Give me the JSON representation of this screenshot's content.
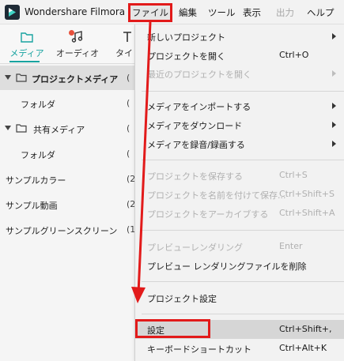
{
  "titlebar": {
    "app_title": "Wondershare Filmora",
    "logo_icon": "filmora-logo-icon",
    "menu": {
      "file": "ファイル",
      "edit": "編集",
      "tool": "ツール",
      "view": "表示",
      "export": "出力",
      "help": "ヘルプ"
    }
  },
  "left_panel": {
    "tabs": [
      {
        "label": "メディア",
        "icon": "folder-icon",
        "active": true
      },
      {
        "label": "オーディオ",
        "icon": "music-note-icon",
        "active": false
      },
      {
        "label": "タイ",
        "icon": "title-icon",
        "active": false
      }
    ],
    "tree": {
      "project_media": "プロジェクトメディア",
      "folder1": "フォルダ",
      "shared_media": "共有メディア",
      "folder2": "フォルダ",
      "sample_color": "サンプルカラー",
      "sample_color_count": "(2",
      "sample_video": "サンプル動画",
      "sample_video_count": "(2",
      "sample_green": "サンプルグリーンスクリーン",
      "sample_green_count": "(1",
      "paren": "("
    }
  },
  "file_menu": {
    "new_project": "新しいプロジェクト",
    "open_project": "プロジェクトを開く",
    "open_project_key": "Ctrl+O",
    "recent_projects": "最近のプロジェクトを開く",
    "import_media": "メディアをインポートする",
    "download_media": "メディアをダウンロード",
    "record_media": "メディアを録音/録画する",
    "save_project": "プロジェクトを保存する",
    "save_project_key": "Ctrl+S",
    "save_as": "プロジェクトを名前を付けて保存...",
    "save_as_key": "Ctrl+Shift+S",
    "archive": "プロジェクトをアーカイブする",
    "archive_key": "Ctrl+Shift+A",
    "preview_render": "プレビューレンダリング",
    "preview_render_key": "Enter",
    "delete_render": "プレビュー レンダリングファイルを削除",
    "project_settings": "プロジェクト設定",
    "settings": "設定",
    "settings_key": "Ctrl+Shift+,",
    "shortcuts": "キーボードショートカット",
    "shortcuts_key": "Ctrl+Alt+K"
  },
  "colors": {
    "accent": "#18a3a0",
    "annotation_red": "#e21a1a",
    "notification_dot": "#e8513c"
  }
}
